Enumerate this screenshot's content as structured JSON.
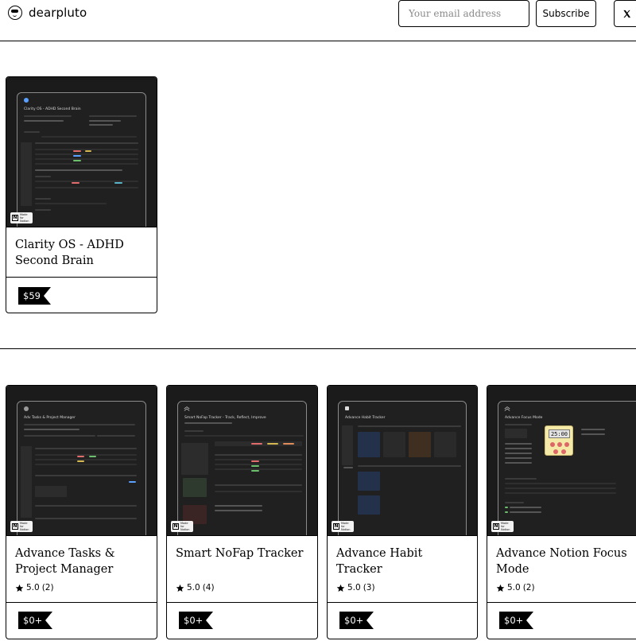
{
  "header": {
    "brand_name": "dearpluto",
    "email_placeholder": "Your email address",
    "subscribe_label": "Subscribe"
  },
  "featured": [
    {
      "title": "Clarity OS - ADHD Second Brain",
      "thumb_title": "Clarity OS - ADHD Second Brain",
      "price": "$59"
    }
  ],
  "products": [
    {
      "title": "Advance Tasks & Project Manager",
      "thumb_title": "Adv Tasks & Project Manager",
      "rating": "5.0",
      "reviews": "(2)",
      "price": "$0+"
    },
    {
      "title": "Smart NoFap Tracker",
      "thumb_title": "Smart NoFap Tracker - Track, Reflect, Improve",
      "rating": "5.0",
      "reviews": "(4)",
      "price": "$0+"
    },
    {
      "title": "Advance Habit Tracker",
      "thumb_title": "Advance Habit Tracker",
      "rating": "5.0",
      "reviews": "(3)",
      "price": "$0+"
    },
    {
      "title": "Advance Notion Focus Mode",
      "thumb_title": "Advance Focus Mode",
      "timer": "25:00",
      "rating": "5.0",
      "reviews": "(2)",
      "price": "$0+"
    }
  ],
  "badge_text": "Made for Notion",
  "colors": {
    "ink": "#000000",
    "thumb_bg": "#1b1b1b",
    "screen_bg": "#202020",
    "timer_bg": "#f5e9a8"
  }
}
